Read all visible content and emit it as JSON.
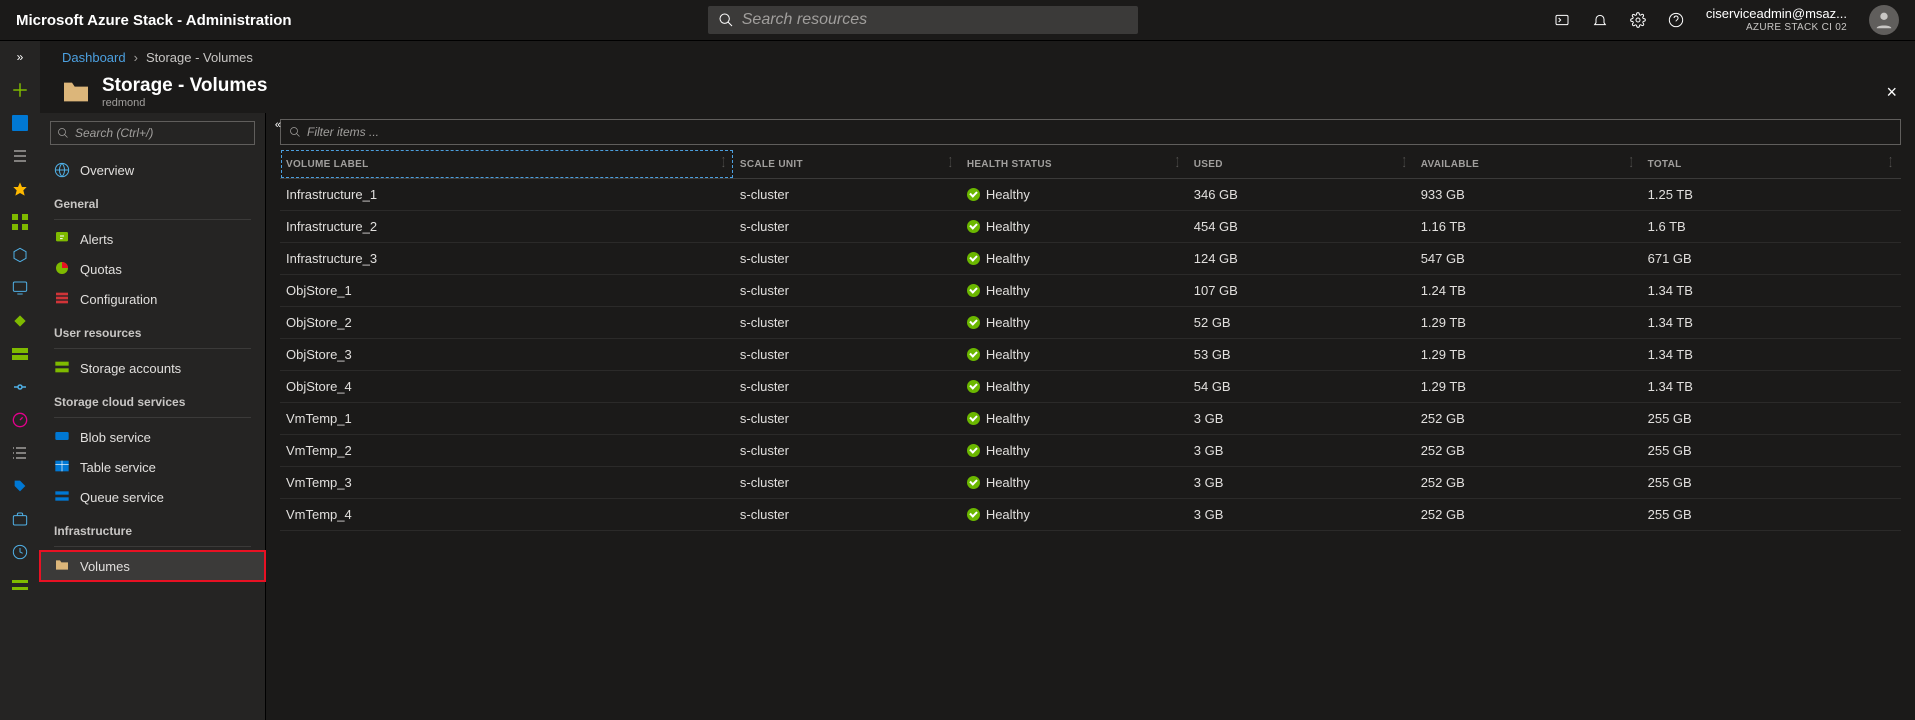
{
  "topbar": {
    "title": "Microsoft Azure Stack - Administration",
    "search_placeholder": "Search resources",
    "account_email": "ciserviceadmin@msaz...",
    "account_tenant": "AZURE STACK CI 02"
  },
  "breadcrumb": {
    "root": "Dashboard",
    "current": "Storage - Volumes"
  },
  "blade": {
    "title": "Storage - Volumes",
    "subtitle": "redmond"
  },
  "nav_search_placeholder": "Search (Ctrl+/)",
  "filter_placeholder": "Filter items ...",
  "nav": {
    "overview": "Overview",
    "groups": [
      {
        "label": "General",
        "items": [
          {
            "key": "alerts",
            "label": "Alerts"
          },
          {
            "key": "quotas",
            "label": "Quotas"
          },
          {
            "key": "configuration",
            "label": "Configuration"
          }
        ]
      },
      {
        "label": "User resources",
        "items": [
          {
            "key": "storage-accounts",
            "label": "Storage accounts"
          }
        ]
      },
      {
        "label": "Storage cloud services",
        "items": [
          {
            "key": "blob-service",
            "label": "Blob service"
          },
          {
            "key": "table-service",
            "label": "Table service"
          },
          {
            "key": "queue-service",
            "label": "Queue service"
          }
        ]
      },
      {
        "label": "Infrastructure",
        "items": [
          {
            "key": "volumes",
            "label": "Volumes",
            "selected": true
          }
        ]
      }
    ]
  },
  "columns": {
    "volume_label": "VOLUME LABEL",
    "scale_unit": "SCALE UNIT",
    "health_status": "HEALTH STATUS",
    "used": "USED",
    "available": "AVAILABLE",
    "total": "TOTAL"
  },
  "health_label": "Healthy",
  "rows": [
    {
      "label": "Infrastructure_1",
      "unit": "s-cluster",
      "health": "Healthy",
      "used": "346 GB",
      "avail": "933 GB",
      "total": "1.25 TB"
    },
    {
      "label": "Infrastructure_2",
      "unit": "s-cluster",
      "health": "Healthy",
      "used": "454 GB",
      "avail": "1.16 TB",
      "total": "1.6 TB"
    },
    {
      "label": "Infrastructure_3",
      "unit": "s-cluster",
      "health": "Healthy",
      "used": "124 GB",
      "avail": "547 GB",
      "total": "671 GB"
    },
    {
      "label": "ObjStore_1",
      "unit": "s-cluster",
      "health": "Healthy",
      "used": "107 GB",
      "avail": "1.24 TB",
      "total": "1.34 TB"
    },
    {
      "label": "ObjStore_2",
      "unit": "s-cluster",
      "health": "Healthy",
      "used": "52 GB",
      "avail": "1.29 TB",
      "total": "1.34 TB"
    },
    {
      "label": "ObjStore_3",
      "unit": "s-cluster",
      "health": "Healthy",
      "used": "53 GB",
      "avail": "1.29 TB",
      "total": "1.34 TB"
    },
    {
      "label": "ObjStore_4",
      "unit": "s-cluster",
      "health": "Healthy",
      "used": "54 GB",
      "avail": "1.29 TB",
      "total": "1.34 TB"
    },
    {
      "label": "VmTemp_1",
      "unit": "s-cluster",
      "health": "Healthy",
      "used": "3 GB",
      "avail": "252 GB",
      "total": "255 GB"
    },
    {
      "label": "VmTemp_2",
      "unit": "s-cluster",
      "health": "Healthy",
      "used": "3 GB",
      "avail": "252 GB",
      "total": "255 GB"
    },
    {
      "label": "VmTemp_3",
      "unit": "s-cluster",
      "health": "Healthy",
      "used": "3 GB",
      "avail": "252 GB",
      "total": "255 GB"
    },
    {
      "label": "VmTemp_4",
      "unit": "s-cluster",
      "health": "Healthy",
      "used": "3 GB",
      "avail": "252 GB",
      "total": "255 GB"
    }
  ]
}
